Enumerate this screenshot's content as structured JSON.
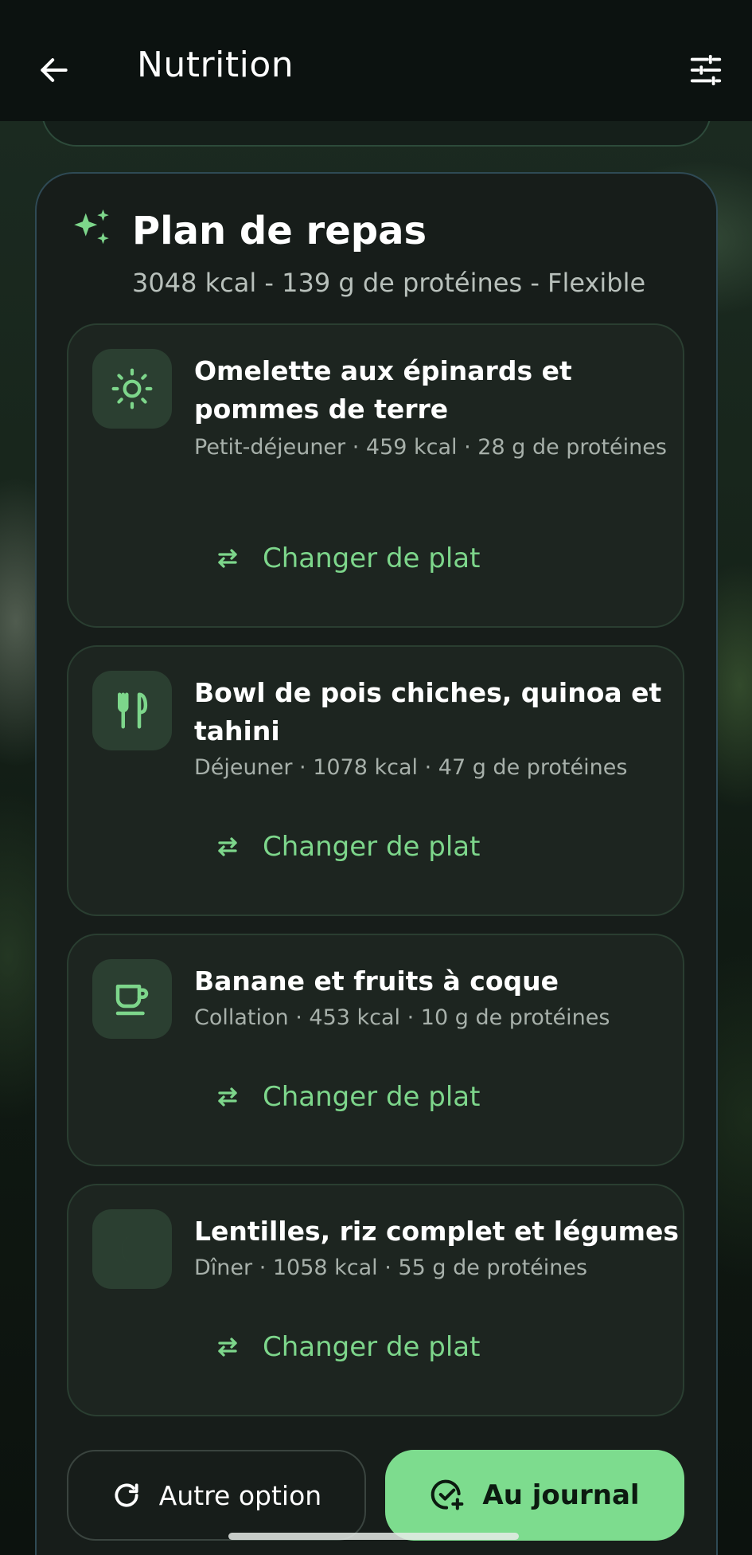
{
  "header": {
    "title": "Nutrition",
    "back_icon": "arrow-left-icon",
    "filter_icon": "sliders-icon"
  },
  "plan": {
    "icon": "sparkles-icon",
    "title": "Plan de repas",
    "subtitle": "3048 kcal - 139 g de protéines - Flexible",
    "meals": [
      {
        "icon": "sun-icon",
        "name": "Omelette aux épinards et pommes de terre",
        "meta": "Petit-déjeuner · 459 kcal · 28 g de protéines",
        "swap_label": "Changer de plat"
      },
      {
        "icon": "utensils-icon",
        "name": "Bowl de pois chiches, quinoa et tahini",
        "meta": "Déjeuner · 1078 kcal · 47 g de protéines",
        "swap_label": "Changer de plat"
      },
      {
        "icon": "coffee-cup-icon",
        "name": "Banane et fruits à coque",
        "meta": "Collation · 453 kcal · 10 g de protéines",
        "swap_label": "Changer de plat"
      },
      {
        "icon": "moon-icon",
        "name": "Lentilles, riz complet et légumes",
        "meta": "Dîner · 1058 kcal · 55 g de protéines",
        "swap_label": "Changer de plat"
      }
    ]
  },
  "actions": {
    "other_label": "Autre option",
    "journal_label": "Au journal"
  },
  "colors": {
    "accent": "#7ddc8e",
    "card_bg": "#1d2520",
    "icon_bg": "#2b3f31"
  }
}
